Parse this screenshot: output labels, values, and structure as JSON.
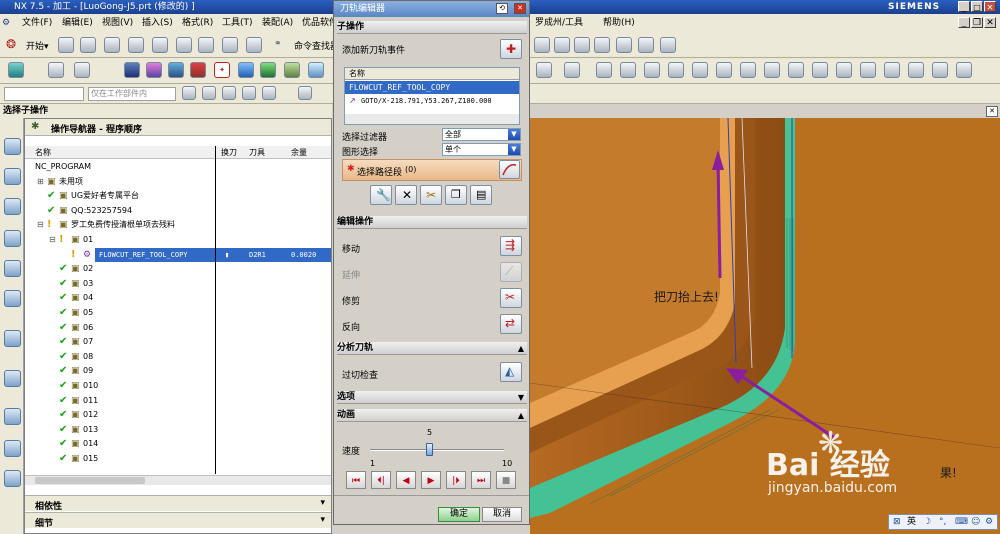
{
  "window": {
    "title": "NX 7.5 - 加工 - [LuoGong-J5.prt  (修改的) ]",
    "brand": "SIEMENS"
  },
  "menu": [
    "文件(F)",
    "编辑(E)",
    "视图(V)",
    "插入(S)",
    "格式(R)",
    "工具(T)",
    "装配(A)",
    "优品软件",
    "罗成州/工具",
    "帮助(H)"
  ],
  "toolbar": {
    "start_label": "开始▾",
    "command_finder": "命令查找器",
    "filter_value": "",
    "filter_placeholder": "仅在工作部件内"
  },
  "navigator": {
    "panel_title": "选择子操作",
    "header": "操作导航器 - 程序顺序",
    "columns": [
      "名称",
      "换刀",
      "刀具",
      "余量"
    ],
    "rows": [
      {
        "indent": 0,
        "status": "",
        "icon": "",
        "name": "NC_PROGRAM",
        "swap": "",
        "tool": "",
        "stock": ""
      },
      {
        "indent": 1,
        "status": "",
        "icon": "folder",
        "name": "未用项",
        "swap": "",
        "tool": "",
        "stock": ""
      },
      {
        "indent": 1,
        "status": "ok",
        "icon": "folder",
        "name": "UG爱好者专属平台",
        "swap": "",
        "tool": "",
        "stock": ""
      },
      {
        "indent": 1,
        "status": "ok",
        "icon": "folder",
        "name": "QQ:523257594",
        "swap": "",
        "tool": "",
        "stock": ""
      },
      {
        "indent": 1,
        "status": "warn",
        "icon": "folder",
        "name": "罗工免费传授清根单项去残料",
        "swap": "",
        "tool": "",
        "stock": ""
      },
      {
        "indent": 2,
        "status": "warn",
        "icon": "folder",
        "name": "01",
        "swap": "",
        "tool": "",
        "stock": ""
      },
      {
        "indent": 3,
        "status": "warn",
        "icon": "op",
        "name": "FLOWCUT_REF_TOOL_COPY",
        "swap": "▮",
        "tool": "D2R1",
        "stock": "0.0020",
        "selected": true
      },
      {
        "indent": 2,
        "status": "ok",
        "icon": "folder",
        "name": "02",
        "swap": "",
        "tool": "",
        "stock": ""
      },
      {
        "indent": 2,
        "status": "ok",
        "icon": "folder",
        "name": "03",
        "swap": "",
        "tool": "",
        "stock": ""
      },
      {
        "indent": 2,
        "status": "ok",
        "icon": "folder",
        "name": "04",
        "swap": "",
        "tool": "",
        "stock": ""
      },
      {
        "indent": 2,
        "status": "ok",
        "icon": "folder",
        "name": "05",
        "swap": "",
        "tool": "",
        "stock": ""
      },
      {
        "indent": 2,
        "status": "ok",
        "icon": "folder",
        "name": "06",
        "swap": "",
        "tool": "",
        "stock": ""
      },
      {
        "indent": 2,
        "status": "ok",
        "icon": "folder",
        "name": "07",
        "swap": "",
        "tool": "",
        "stock": ""
      },
      {
        "indent": 2,
        "status": "ok",
        "icon": "folder",
        "name": "08",
        "swap": "",
        "tool": "",
        "stock": ""
      },
      {
        "indent": 2,
        "status": "ok",
        "icon": "folder",
        "name": "09",
        "swap": "",
        "tool": "",
        "stock": ""
      },
      {
        "indent": 2,
        "status": "ok",
        "icon": "folder",
        "name": "010",
        "swap": "",
        "tool": "",
        "stock": ""
      },
      {
        "indent": 2,
        "status": "ok",
        "icon": "folder",
        "name": "011",
        "swap": "",
        "tool": "",
        "stock": ""
      },
      {
        "indent": 2,
        "status": "ok",
        "icon": "folder",
        "name": "012",
        "swap": "",
        "tool": "",
        "stock": ""
      },
      {
        "indent": 2,
        "status": "ok",
        "icon": "folder",
        "name": "013",
        "swap": "",
        "tool": "",
        "stock": ""
      },
      {
        "indent": 2,
        "status": "ok",
        "icon": "folder",
        "name": "014",
        "swap": "",
        "tool": "",
        "stock": ""
      },
      {
        "indent": 2,
        "status": "ok",
        "icon": "folder",
        "name": "015",
        "swap": "",
        "tool": "",
        "stock": ""
      }
    ],
    "dependency": "相依性",
    "details": "细节"
  },
  "dialog": {
    "title": "刀轨编辑器",
    "sub_op": {
      "header": "子操作",
      "add_event": "添加新刀轨事件",
      "list_header": "名称",
      "list_items": [
        "FLOWCUT_REF_TOOL_COPY",
        "GOTO/X-218.791,Y53.267,Z100.000"
      ]
    },
    "filter": {
      "label": "选择过滤器",
      "value": "全部"
    },
    "graphic": {
      "label": "图形选择",
      "value": "单个"
    },
    "select_path": "选择路径段",
    "select_count": "(0)",
    "edit": {
      "header": "编辑操作",
      "move": "移动",
      "extend": "延伸",
      "trim": "修剪",
      "reverse": "反向"
    },
    "analysis": {
      "header": "分析刀轨",
      "gouge": "过切检查"
    },
    "options": "选项",
    "animation": {
      "header": "动画",
      "speed_label": "速度",
      "speed_value": "5",
      "speed_min": "1",
      "speed_max": "10",
      "speed_level": 0.44
    },
    "ok": "确定",
    "cancel": "取消"
  },
  "viewport": {
    "annotation1": "把刀抬上去!",
    "annotation2": "果!",
    "watermark_logo": "Bai 经验",
    "watermark_url": "jingyan.baidu.com",
    "arrow_color": "#8a1ea0",
    "toolpath_color": "#2fd0a8",
    "ime_label": "英"
  }
}
